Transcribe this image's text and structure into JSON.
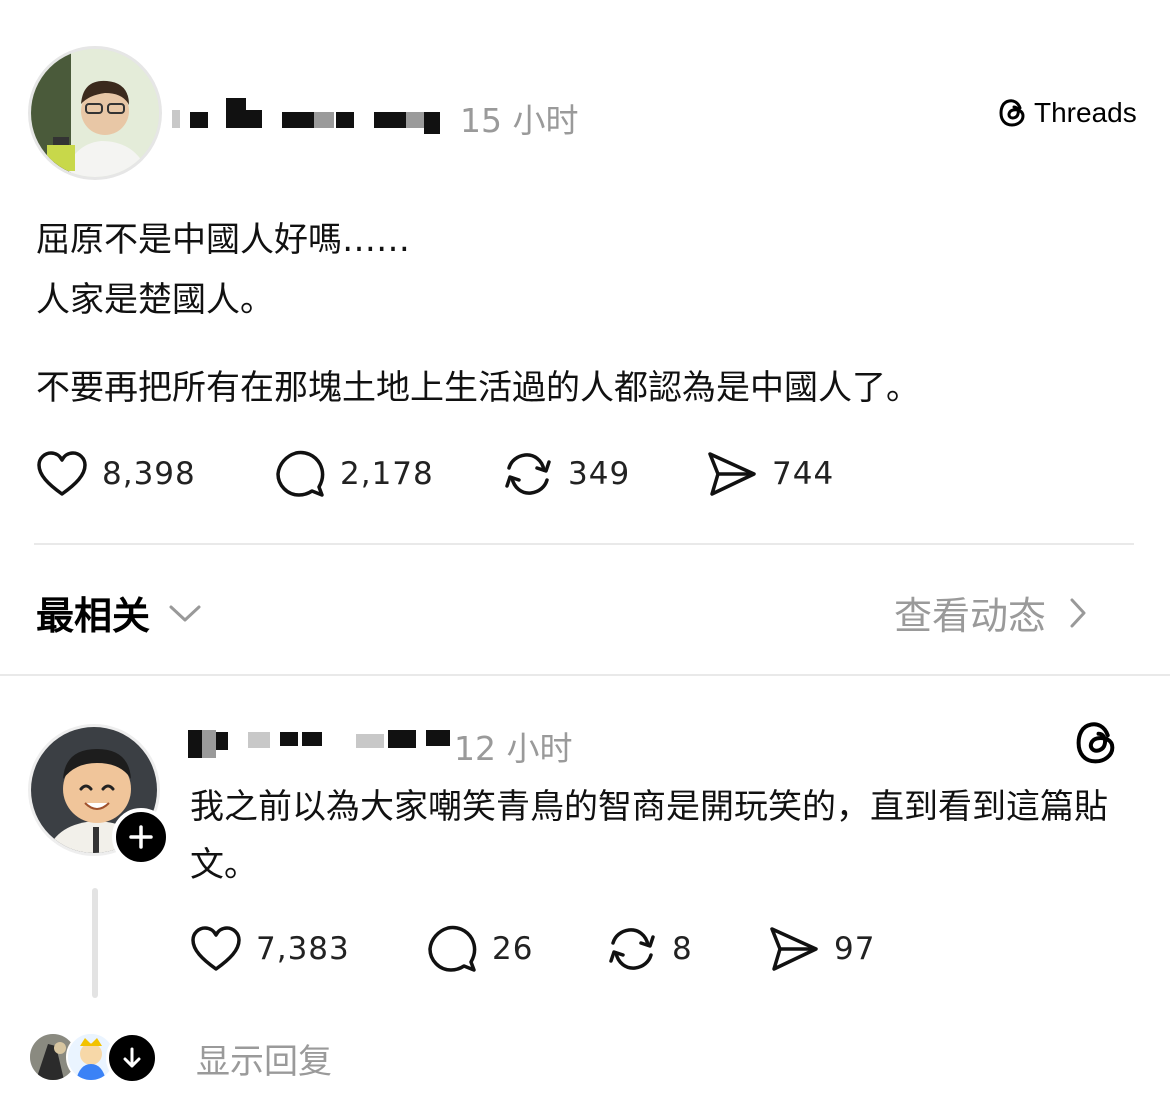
{
  "header": {
    "time": "15 小时",
    "brand": "Threads"
  },
  "post": {
    "lines": [
      "屈原不是中國人好嗎……",
      "人家是楚國人。",
      "不要再把所有在那塊土地上生活過的人都認為是中國人了。"
    ],
    "actions": {
      "likes": "8,398",
      "comments": "2,178",
      "reposts": "349",
      "shares": "744"
    }
  },
  "sort_bar": {
    "label": "最相关",
    "view_activity": "查看动态"
  },
  "reply": {
    "time": "12 小时",
    "text": "我之前以為大家嘲笑青鳥的智商是開玩笑的，直到看到這篇貼文。",
    "actions": {
      "likes": "7,383",
      "comments": "26",
      "reposts": "8",
      "shares": "97"
    }
  },
  "footer": {
    "show_replies": "显示回复"
  }
}
